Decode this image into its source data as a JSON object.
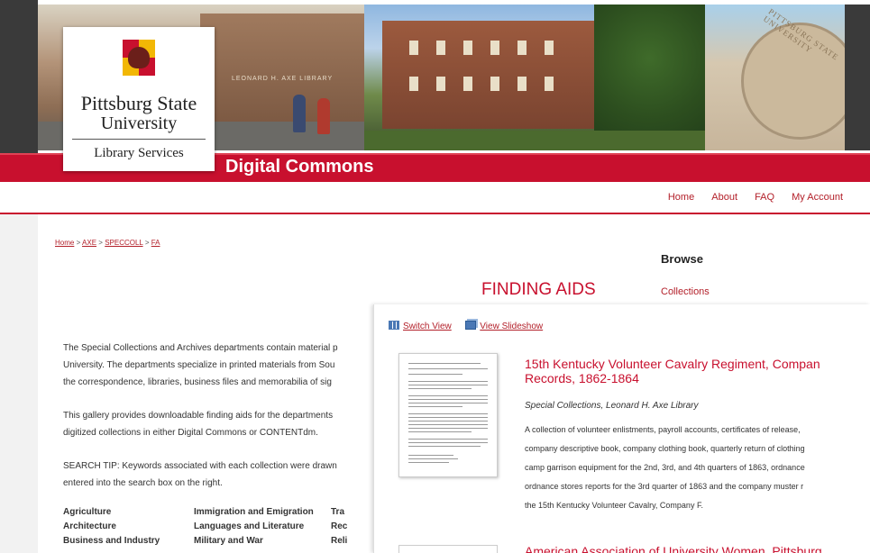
{
  "banner": {
    "logo_line1": "Pittsburg State",
    "logo_line2": "University",
    "logo_line3": "Library Services",
    "building_sign": "LEONARD H. AXE LIBRARY",
    "seal_text": "PITTSBURG STATE UNIVERSITY",
    "site_title": "Digital Commons"
  },
  "nav": {
    "items": [
      "Home",
      "About",
      "FAQ",
      "My Account"
    ]
  },
  "breadcrumb": {
    "items": [
      "Home",
      "AXE",
      "SPECCOLL",
      "FA"
    ],
    "separator": ">"
  },
  "sidebar": {
    "browse_label": "Browse",
    "collections_label": "Collections"
  },
  "main": {
    "title": "FINDING AIDS",
    "paragraphs": [
      "The Special Collections and Archives departments contain material p",
      "University. The departments specialize in printed materials from Sou",
      "the correspondence, libraries, business files and memorabilia of sig",
      "This gallery provides downloadable finding aids for the departments",
      "digitized collections in either Digital Commons or CONTENTdm.",
      "SEARCH TIP: Keywords associated with each collection were drawn",
      "entered into the search box on the right."
    ],
    "categories": {
      "col1": [
        "Agriculture",
        "Architecture",
        "Business and Industry"
      ],
      "col2": [
        "Immigration and Emigration",
        "Languages and Literature",
        "Military and War"
      ],
      "col3": [
        "Tra",
        "Rec",
        "Reli"
      ]
    }
  },
  "overlay": {
    "switch_view": "Switch View",
    "view_slideshow": "View Slideshow",
    "item1": {
      "title_line1": "15th Kentucky Volunteer Cavalry Regiment, Compan",
      "title_line2": "Records, 1862-1864",
      "source": "Special Collections, Leonard H. Axe Library",
      "desc": [
        "A collection of volunteer enlistments, payroll accounts, certificates of release,",
        "company descriptive book, company clothing book, quarterly return of clothing",
        "camp garrison equipment for the 2nd, 3rd, and 4th quarters of 1863, ordnance",
        "ordnance stores reports for the 3rd quarter of 1863 and the company muster r",
        "the 15th Kentucky Volunteer Cavalry, Company F."
      ]
    },
    "item2": {
      "title": "American Association of University Women, Pittsburg"
    }
  },
  "colors": {
    "brand_red": "#c8102e",
    "link_red": "#b3202a",
    "logo_gold": "#f2b705"
  }
}
